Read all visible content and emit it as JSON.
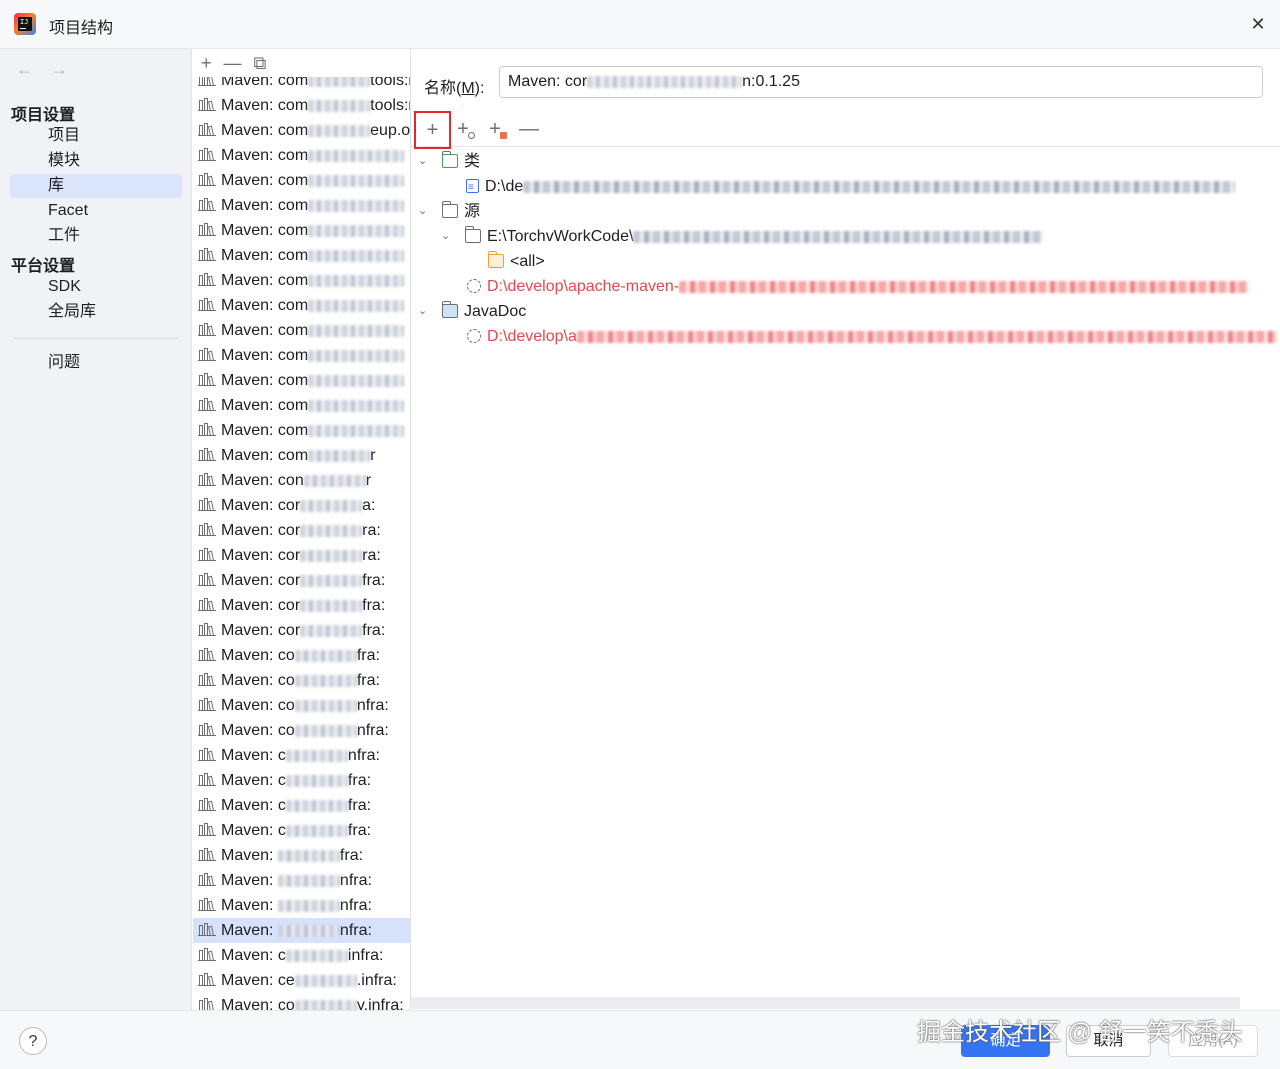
{
  "window": {
    "title": "项目结构",
    "close_icon": "close-icon"
  },
  "nav": {
    "sections": [
      {
        "title": "项目设置",
        "items": [
          "项目",
          "模块",
          "库",
          "Facet",
          "工件"
        ]
      },
      {
        "title": "平台设置",
        "items": [
          "SDK",
          "全局库"
        ]
      }
    ],
    "problems": "问题",
    "selected": "库"
  },
  "library_list": {
    "prefix": "Maven: ",
    "rows": [
      {
        "visible": "com",
        "suffix": "tools:r"
      },
      {
        "visible": "com",
        "suffix": "tools:r"
      },
      {
        "visible": "com",
        "suffix": "eup.ok"
      },
      {
        "visible": "com",
        "suffix": ""
      },
      {
        "visible": "com",
        "suffix": ""
      },
      {
        "visible": "com",
        "suffix": ""
      },
      {
        "visible": "com",
        "suffix": ""
      },
      {
        "visible": "com",
        "suffix": ""
      },
      {
        "visible": "com",
        "suffix": ""
      },
      {
        "visible": "com",
        "suffix": ""
      },
      {
        "visible": "com",
        "suffix": ""
      },
      {
        "visible": "com",
        "suffix": ""
      },
      {
        "visible": "com",
        "suffix": ""
      },
      {
        "visible": "com",
        "suffix": ""
      },
      {
        "visible": "com",
        "suffix": ""
      },
      {
        "visible": "com",
        "suffix": "r"
      },
      {
        "visible": "con",
        "suffix": "r"
      },
      {
        "visible": "cor",
        "suffix": "a:"
      },
      {
        "visible": "cor",
        "suffix": "ra:"
      },
      {
        "visible": "cor",
        "suffix": "ra:"
      },
      {
        "visible": "cor",
        "suffix": "fra:"
      },
      {
        "visible": "cor",
        "suffix": "fra:"
      },
      {
        "visible": "cor",
        "suffix": "fra:"
      },
      {
        "visible": "co",
        "suffix": "fra:"
      },
      {
        "visible": "co",
        "suffix": "fra:"
      },
      {
        "visible": "co",
        "suffix": "nfra:"
      },
      {
        "visible": "co",
        "suffix": "nfra:"
      },
      {
        "visible": "c",
        "suffix": "nfra:"
      },
      {
        "visible": "c",
        "suffix": "fra:"
      },
      {
        "visible": "c",
        "suffix": "fra:"
      },
      {
        "visible": "c",
        "suffix": "fra:"
      },
      {
        "visible": "",
        "suffix": "fra:"
      },
      {
        "visible": "",
        "suffix": "nfra:"
      },
      {
        "visible": "",
        "suffix": "nfra:"
      },
      {
        "visible": "",
        "suffix": "nfra:"
      },
      {
        "visible": "c",
        "suffix": "infra:"
      },
      {
        "visible": "ce",
        "suffix": ".infra:"
      },
      {
        "visible": "co",
        "suffix": "y.infra:"
      }
    ],
    "selected_index": 34
  },
  "detail": {
    "name_label": "名称(",
    "name_mnemonic": "M",
    "name_label_end": "):",
    "name_value_start": "Maven: cor",
    "name_value_end": "n:0.1.25",
    "tree": {
      "classes": {
        "label": "类",
        "path": "D:\\de"
      },
      "sources": {
        "label": "源",
        "path": "E:\\TorchvWorkCode\\",
        "child": "<all>",
        "missing_path": "D:\\develop\\apache-maven-"
      },
      "javadoc": {
        "label": "JavaDoc",
        "missing_path": "D:\\develop\\a"
      }
    }
  },
  "footer": {
    "help": "?",
    "ok": "确定",
    "cancel": "取消",
    "apply": "应用(A)"
  },
  "watermark": "掘金技术社区 @ 舒一笑不秃头",
  "colors": {
    "accent": "#3574f0",
    "selected": "#d6e2fb",
    "error": "#e5484d",
    "highlight_border": "#e0292b"
  }
}
